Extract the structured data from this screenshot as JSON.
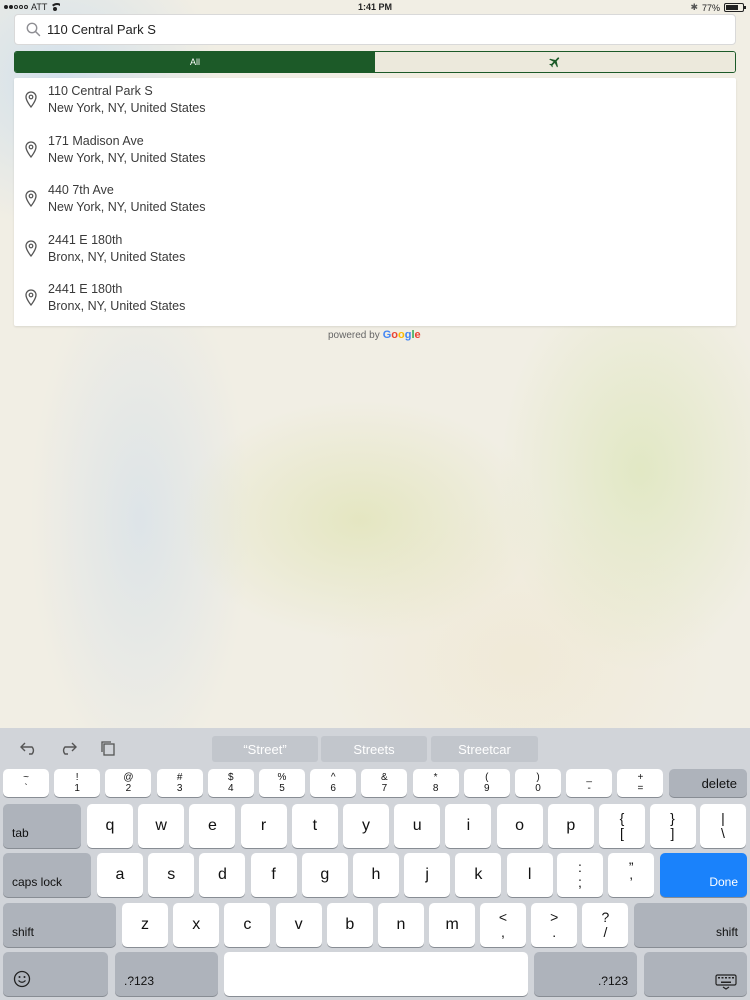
{
  "status_bar": {
    "carrier": "ATT",
    "time": "1:41 PM",
    "battery": "77%",
    "battery_level": 0.77
  },
  "search": {
    "value": "110 Central Park S",
    "placeholder": ""
  },
  "filter": {
    "all_label": "All",
    "active": "All",
    "second_icon": "airplane-icon"
  },
  "suggestions": [
    {
      "line1": "110 Central Park S",
      "line2": "New York, NY, United States"
    },
    {
      "line1": "171 Madison Ave",
      "line2": "New York, NY, United States"
    },
    {
      "line1": "440 7th Ave",
      "line2": "New York, NY, United States"
    },
    {
      "line1": "2441 E 180th",
      "line2": "Bronx, NY, United States"
    },
    {
      "line1": "2441 E 180th",
      "line2": "Bronx, NY, United States"
    }
  ],
  "attribution": {
    "prefix": "powered by",
    "brand": [
      "G",
      "o",
      "o",
      "g",
      "l",
      "e"
    ]
  },
  "keyboard": {
    "predictions": [
      "“Street”",
      "Streets",
      "Streetcar"
    ],
    "row1": [
      [
        "~",
        "`"
      ],
      [
        "!",
        "1"
      ],
      [
        "@",
        "2"
      ],
      [
        "#",
        "3"
      ],
      [
        "$",
        "4"
      ],
      [
        "%",
        "5"
      ],
      [
        "^",
        "6"
      ],
      [
        "&",
        "7"
      ],
      [
        "*",
        "8"
      ],
      [
        "(",
        "9"
      ],
      [
        ")",
        "0"
      ],
      [
        "_",
        "-"
      ],
      [
        "+",
        "="
      ]
    ],
    "delete": "delete",
    "tab": "tab",
    "row2": [
      "q",
      "w",
      "e",
      "r",
      "t",
      "y",
      "u",
      "i",
      "o",
      "p"
    ],
    "row2_extra": [
      [
        "{",
        "["
      ],
      [
        "}",
        "]"
      ],
      [
        "|",
        "\\"
      ]
    ],
    "caps": "caps lock",
    "row3": [
      "a",
      "s",
      "d",
      "f",
      "g",
      "h",
      "j",
      "k",
      "l"
    ],
    "row3_extra": [
      [
        ":",
        ";"
      ],
      [
        "”",
        "’"
      ]
    ],
    "done": "Done",
    "shift_left": "shift",
    "row4": [
      "z",
      "x",
      "c",
      "v",
      "b",
      "n",
      "m"
    ],
    "row4_extra": [
      [
        "<",
        ","
      ],
      [
        ">",
        "."
      ],
      [
        "?",
        "/"
      ]
    ],
    "shift_right": "shift",
    "num_left": ".?123",
    "num_right": ".?123",
    "icons": [
      "undo-icon",
      "redo-icon",
      "paste-icon",
      "emoji-icon",
      "hide-keyboard-icon"
    ],
    "accent_color": "#1a82fb"
  },
  "colors": {
    "brand": "#1c5a28",
    "pin": "#555555"
  }
}
